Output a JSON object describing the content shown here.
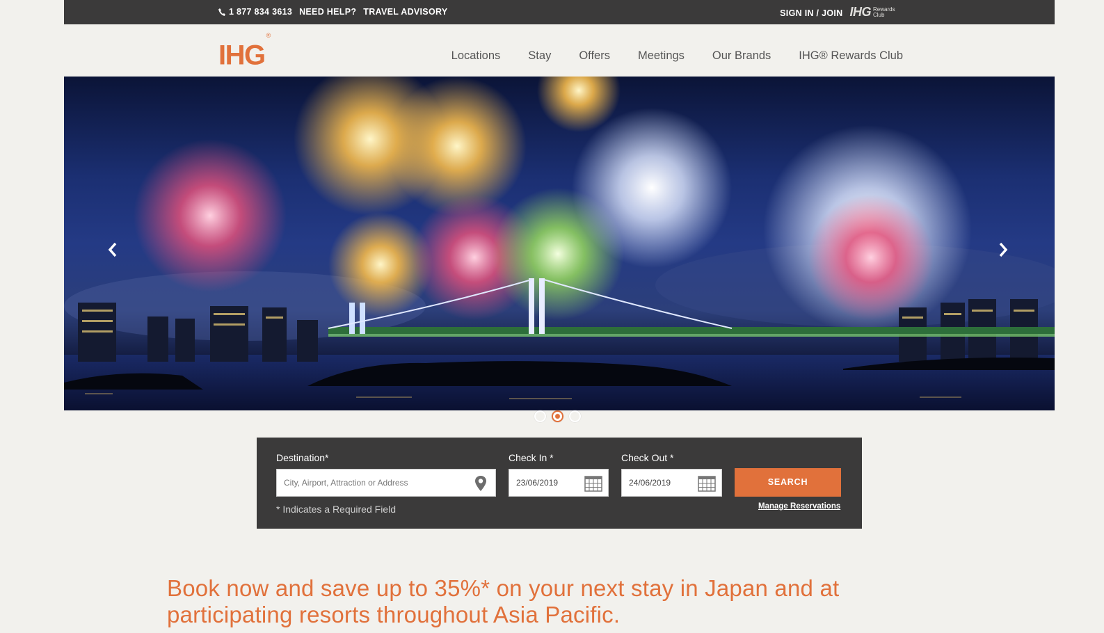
{
  "topbar": {
    "phone": "1 877 834 3613",
    "need_help": "NEED HELP?",
    "travel_advisory": "TRAVEL ADVISORY",
    "sign_in": "SIGN IN / JOIN",
    "rewards_logo_text": "IHG",
    "rewards_logo_sub": "Rewards Club"
  },
  "header": {
    "logo": "IHG",
    "logo_mark": "®",
    "nav": [
      "Locations",
      "Stay",
      "Offers",
      "Meetings",
      "Our Brands",
      "IHG® Rewards Club"
    ]
  },
  "carousel": {
    "slide_count": 3,
    "active_slide": 2
  },
  "search": {
    "destination_label": "Destination*",
    "destination_placeholder": "City, Airport, Attraction or Address",
    "checkin_label": "Check In *",
    "checkin_value": "23/06/2019",
    "checkout_label": "Check Out *",
    "checkout_value": "24/06/2019",
    "search_button": "SEARCH",
    "manage_link": "Manage Reservations",
    "required_note": "* Indicates a Required Field"
  },
  "promo": {
    "headline": "Book now and save up to 35%* on your next stay in Japan and at participating resorts throughout Asia Pacific."
  },
  "colors": {
    "brand_orange": "#e1713b",
    "dark_bar": "#3b3a3a",
    "background": "#f2f1ed"
  },
  "icons": [
    "phone-icon",
    "map-pin-icon",
    "calendar-icon",
    "chevron-left-icon",
    "chevron-right-icon"
  ]
}
